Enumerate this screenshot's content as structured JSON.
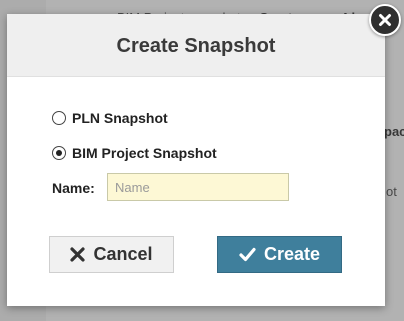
{
  "background": {
    "row1_label": "BIM Project snapshot:",
    "row1_value": "Create every 4 ho",
    "side_fragment_1": "pac",
    "side_fragment_2": "ot"
  },
  "dialog": {
    "title": "Create Snapshot",
    "options": [
      {
        "label": "PLN Snapshot",
        "selected": false
      },
      {
        "label": "BIM Project Snapshot",
        "selected": true
      }
    ],
    "name_label": "Name:",
    "name_value": "",
    "name_placeholder": "Name",
    "cancel_label": "Cancel",
    "create_label": "Create",
    "close_icon": "close-icon",
    "colors": {
      "create_button": "#3f7f9c",
      "input_background": "#fdf8d5"
    }
  }
}
